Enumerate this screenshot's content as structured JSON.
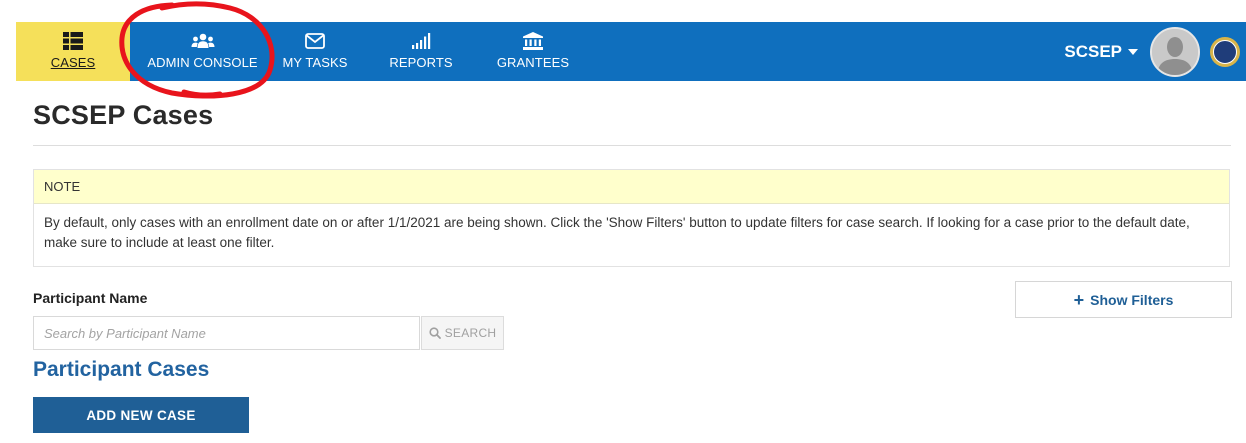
{
  "nav": {
    "items": [
      {
        "label": "CASES",
        "icon": "list-icon",
        "active": true
      },
      {
        "label": "ADMIN CONSOLE",
        "icon": "users-icon",
        "active": false
      },
      {
        "label": "MY TASKS",
        "icon": "envelope-icon",
        "active": false
      },
      {
        "label": "REPORTS",
        "icon": "signal-bars-icon",
        "active": false
      },
      {
        "label": "GRANTEES",
        "icon": "bank-icon",
        "active": false
      }
    ],
    "user_label": "SCSEP"
  },
  "colors": {
    "nav_bg": "#0f6fbe",
    "active_bg": "#f5e05a",
    "note_bg": "#ffffcc",
    "primary": "#1f5f96",
    "annotation": "#e8141c"
  },
  "page": {
    "title": "SCSEP Cases"
  },
  "note": {
    "heading": "NOTE",
    "body": "By default, only cases with an enrollment date on or after 1/1/2021 are being shown. Click the 'Show Filters' button to update filters for case search. If looking for a case prior to the default date, make sure to include at least one filter."
  },
  "search": {
    "label": "Participant Name",
    "placeholder": "Search by Participant Name",
    "button_label": "SEARCH"
  },
  "filters": {
    "button_label": "Show Filters"
  },
  "cases": {
    "section_title": "Participant Cases",
    "add_label": "ADD NEW CASE"
  }
}
